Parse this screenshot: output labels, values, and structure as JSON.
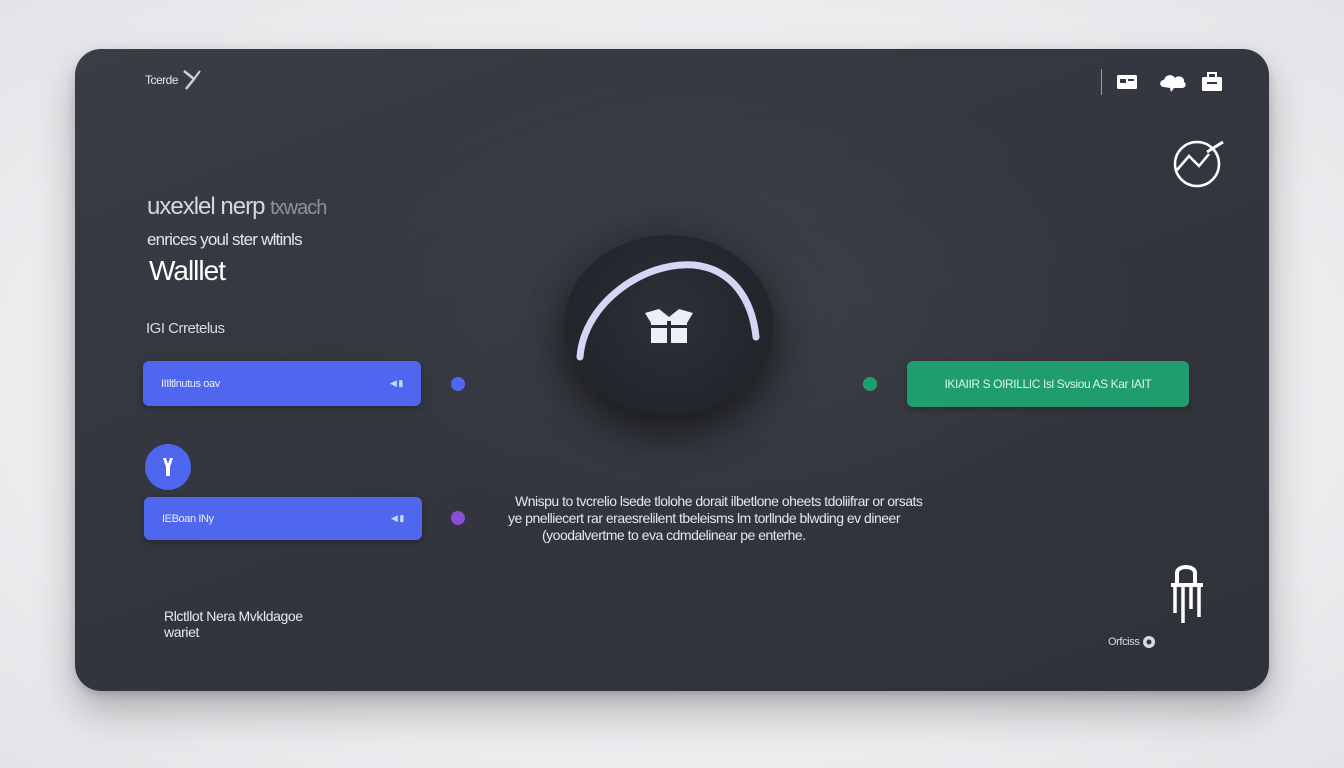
{
  "brand": {
    "name": "Tcerde"
  },
  "header": {
    "icons": [
      "card-icon",
      "cloud-icon",
      "briefcase-icon"
    ]
  },
  "hero": {
    "eyebrow": "uxexlel nerp",
    "eyebrow_faint": "txwach",
    "subtitle": "enrices youl ster wltinls",
    "title": "Walllet"
  },
  "section": {
    "label": "IGI Crretelus"
  },
  "buttons": {
    "primary": {
      "label": "IIIltlnutus oav",
      "arrow": "◀ ▮"
    },
    "secondary": {
      "label": "IEBoan INy",
      "arrow": "◀ ▮"
    },
    "action": {
      "label": "IKIAIIR S OIRILLIC Isl Svsiou AS Kar IAIT"
    }
  },
  "indicator_colors": {
    "blue": "#4f66ee",
    "green": "#1f9d6e",
    "purple": "#8a4fd4"
  },
  "description": {
    "lines": [
      "Wnispu to tvcrelio lsede tlolohe dorait ilbetlone oheets tdoliifrar or orsats",
      "ye pnelliecert rar eraesrelilent tbeleisms lm torllnde blwding ev dineer",
      "(yoodalvertme to eva cdmdelinear pe enterhe."
    ]
  },
  "footer": {
    "left_line1": "Rlctllot Nera Mvkldagoe",
    "left_line2": "wariet",
    "right_text": "Orfciss"
  }
}
